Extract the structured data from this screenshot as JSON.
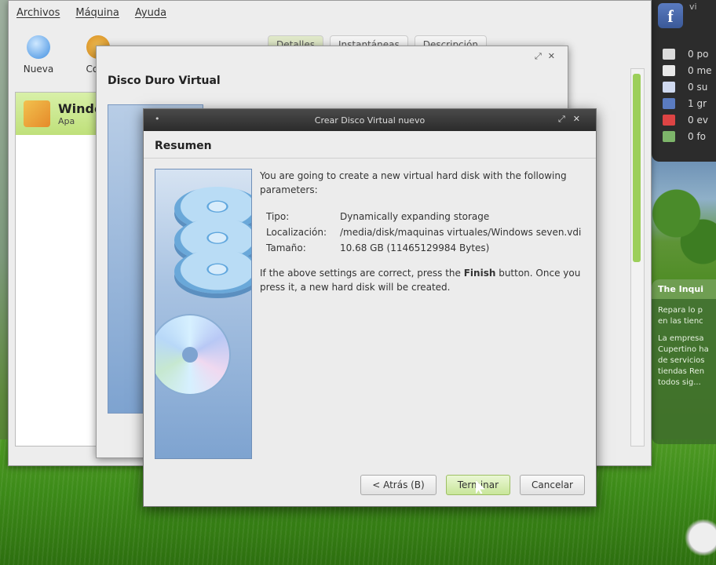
{
  "vbox": {
    "menu": [
      "Archivos",
      "Máquina",
      "Ayuda"
    ],
    "toolbar": [
      "Nueva",
      "Confi"
    ],
    "tabs": [
      "Detalles",
      "Instantáneas",
      "Descripción"
    ],
    "vm": {
      "name": "Windo",
      "state": "Apa"
    }
  },
  "social": {
    "items": [
      {
        "icon": "pencil-icon",
        "label": "0 po",
        "color": "#dcdcdc"
      },
      {
        "icon": "mail-icon",
        "label": "0 me",
        "color": "#e8e8e8"
      },
      {
        "icon": "people-icon",
        "label": "0 su",
        "color": "#cfd9ef"
      },
      {
        "icon": "groups-icon",
        "label": "1 gr",
        "color": "#5a7bc0"
      },
      {
        "icon": "calendar-icon",
        "label": "0 ev",
        "color": "#d44"
      },
      {
        "icon": "photo-icon",
        "label": "0 fo",
        "color": "#7db56a"
      }
    ]
  },
  "news": {
    "title": "The Inqui",
    "p1": "Repara lo p en las tienc",
    "p2": "La empresa Cupertino ha de servicios tiendas Ren todos sig..."
  },
  "wizard_back": {
    "title": "Disco Duro Virtual"
  },
  "dialog": {
    "window_title": "Crear Disco Virtual nuevo",
    "header": "Resumen",
    "intro": "You are going to create a new virtual hard disk with the following parameters:",
    "params": [
      {
        "key": "Tipo:",
        "value": "Dynamically expanding storage"
      },
      {
        "key": "Localización:",
        "value": "/media/disk/maquinas virtuales/Windows seven.vdi"
      },
      {
        "key": "Tamaño:",
        "value": "10.68 GB (11465129984 Bytes)"
      }
    ],
    "outro_prefix": "If the above settings are correct, press the ",
    "outro_bold": "Finish",
    "outro_suffix": " button. Once you press it, a new hard disk will be created.",
    "buttons": {
      "back": "< Atrás (B)",
      "finish": "Terminar",
      "cancel": "Cancelar"
    }
  }
}
